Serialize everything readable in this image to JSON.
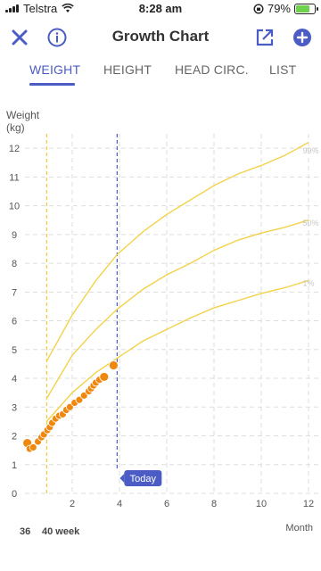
{
  "status": {
    "carrier": "Telstra",
    "time": "8:28 am",
    "battery": "79%",
    "battery_level": 0.79
  },
  "header": {
    "title": "Growth Chart"
  },
  "tabs": [
    {
      "label": "WEIGHT",
      "active": true
    },
    {
      "label": "HEIGHT",
      "active": false
    },
    {
      "label": "HEAD CIRC.",
      "active": false
    },
    {
      "label": "LIST",
      "active": false
    }
  ],
  "icons": {
    "close": "close-icon",
    "info": "info-icon",
    "share": "share-icon",
    "add": "add-icon"
  },
  "colors": {
    "accent": "#4b5cc4",
    "percentile": "#f3d24a",
    "points": "#f0880f",
    "gestation_line": "#f3c93a",
    "today_line": "#4b5cc4"
  },
  "chart_data": {
    "type": "line",
    "ylabel": "Weight\n(kg)",
    "xlabel": "Month",
    "ylim": [
      0,
      12.5
    ],
    "xlim": [
      0,
      12
    ],
    "yticks": [
      0,
      1,
      2,
      3,
      4,
      5,
      6,
      7,
      8,
      9,
      10,
      11,
      12
    ],
    "xticks": [
      2,
      4,
      6,
      8,
      10,
      12
    ],
    "grid": true,
    "extra_labels": [
      "36",
      "40 week"
    ],
    "today_label": "Today",
    "today_x": 3.9,
    "term_x": 0.92,
    "series": [
      {
        "name": "99%",
        "x": [
          0.92,
          2,
          3,
          3.9,
          5,
          6,
          7,
          8,
          9,
          10,
          11,
          12
        ],
        "values": [
          4.6,
          6.2,
          7.4,
          8.3,
          9.1,
          9.7,
          10.2,
          10.7,
          11.1,
          11.4,
          11.75,
          12.2
        ]
      },
      {
        "name": "50%",
        "x": [
          0.92,
          2,
          3,
          3.9,
          5,
          6,
          7,
          8,
          9,
          10,
          11,
          12
        ],
        "values": [
          3.3,
          4.8,
          5.7,
          6.4,
          7.1,
          7.6,
          8.0,
          8.45,
          8.8,
          9.05,
          9.25,
          9.5
        ]
      },
      {
        "name": "1%",
        "x": [
          0.92,
          2,
          3,
          3.9,
          5,
          6,
          7,
          8,
          9,
          10,
          11,
          12
        ],
        "values": [
          2.5,
          3.5,
          4.2,
          4.7,
          5.3,
          5.7,
          6.1,
          6.45,
          6.7,
          6.95,
          7.15,
          7.4
        ]
      },
      {
        "name": "",
        "x": [
          0.1,
          0.2,
          0.35,
          0.55,
          0.7,
          0.8,
          0.95,
          1.05,
          1.15,
          1.3,
          1.45,
          1.6,
          1.75,
          1.9,
          2.1,
          2.3,
          2.5,
          2.7,
          2.8,
          2.9,
          3.0,
          3.15,
          3.35,
          3.75
        ],
        "values": [
          1.75,
          1.55,
          1.6,
          1.8,
          1.95,
          2.05,
          2.2,
          2.3,
          2.45,
          2.6,
          2.7,
          2.75,
          2.9,
          3.0,
          3.15,
          3.25,
          3.4,
          3.55,
          3.65,
          3.75,
          3.85,
          3.95,
          4.05,
          4.45
        ]
      }
    ]
  }
}
